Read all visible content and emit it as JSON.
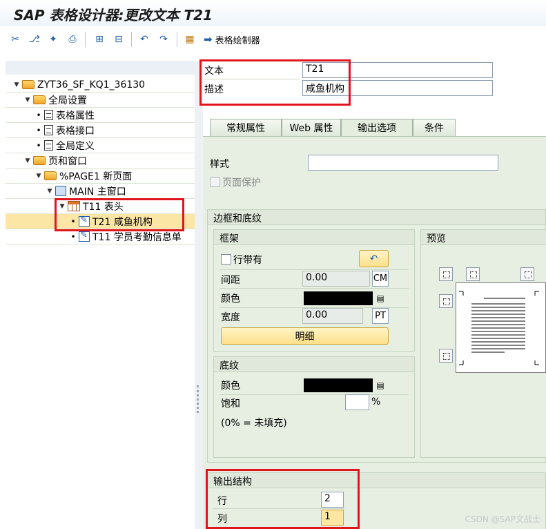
{
  "window": {
    "title": "SAP 表格设计器:更改文本 T21"
  },
  "toolbar": {
    "icons": [
      "cut-icon",
      "branch-icon",
      "wand-icon",
      "print-icon",
      "expand-icon",
      "collapse-icon",
      "undo-icon",
      "redo-icon",
      "form-painter-icon"
    ],
    "table_painter_label": "表格绘制器"
  },
  "tree": {
    "items": [
      {
        "label": "ZYT36_SF_KQ1_36130",
        "icon": "folder-icon",
        "level": 0,
        "expander": "down"
      },
      {
        "label": "全局设置",
        "icon": "folder-icon",
        "level": 1,
        "expander": "down"
      },
      {
        "label": "表格属性",
        "icon": "document-icon",
        "level": 2,
        "expander": "bullet"
      },
      {
        "label": "表格接口",
        "icon": "document-icon",
        "level": 2,
        "expander": "bullet"
      },
      {
        "label": "全局定义",
        "icon": "document-icon",
        "level": 2,
        "expander": "bullet"
      },
      {
        "label": "页和窗口",
        "icon": "folder-icon",
        "level": 1,
        "expander": "down"
      },
      {
        "label": "%PAGE1 新页面",
        "icon": "folder-icon",
        "level": 2,
        "expander": "down"
      },
      {
        "label": "MAIN 主窗口",
        "icon": "window-icon",
        "level": 3,
        "expander": "down"
      },
      {
        "label": "T11 表头",
        "icon": "table-icon",
        "level": 4,
        "expander": "down"
      },
      {
        "label": "T21 咸鱼机构",
        "icon": "text-edit-icon",
        "level": 5,
        "expander": "bullet",
        "selected": true
      },
      {
        "label": "T11 学员考勤信息单",
        "icon": "text-edit-icon",
        "level": 5,
        "expander": "bullet"
      }
    ]
  },
  "header": {
    "text_label": "文本",
    "text_value": "T21",
    "desc_label": "描述",
    "desc_value": "咸鱼机构"
  },
  "tabs": [
    {
      "label": "常规属性",
      "active": false
    },
    {
      "label": "Web 属性",
      "active": false
    },
    {
      "label": "输出选项",
      "active": true
    },
    {
      "label": "条件",
      "active": false
    }
  ],
  "output_options": {
    "style_label": "样式",
    "style_value": "",
    "page_protect_label": "页面保护",
    "page_protect_checked": false
  },
  "borders": {
    "group_title": "边框和底纹",
    "frame": {
      "title": "框架",
      "with_label": "行带有",
      "with_checked": false,
      "spacing_label": "间距",
      "spacing_value": "0.00",
      "spacing_unit": "CM",
      "color_label": "颜色",
      "color_value": "#000000",
      "width_label": "宽度",
      "width_value": "0.00",
      "width_unit": "PT",
      "detail_button": "明细"
    },
    "preview": {
      "title": "预览"
    },
    "shading": {
      "title": "底纹",
      "color_label": "颜色",
      "color_value": "#000000",
      "saturation_label": "饱和",
      "saturation_value": "",
      "percent_sign": "%",
      "hint": "(0% = 未填充)"
    }
  },
  "output_structure": {
    "title": "输出结构",
    "row_label": "行",
    "row_value": "2",
    "col_label": "列",
    "col_value": "1"
  },
  "watermark": "CSDN @SAP文战士",
  "colors": {
    "highlight_red": "#e0141c",
    "selection": "#fbe6a6",
    "panel_green": "#e7eee2"
  }
}
